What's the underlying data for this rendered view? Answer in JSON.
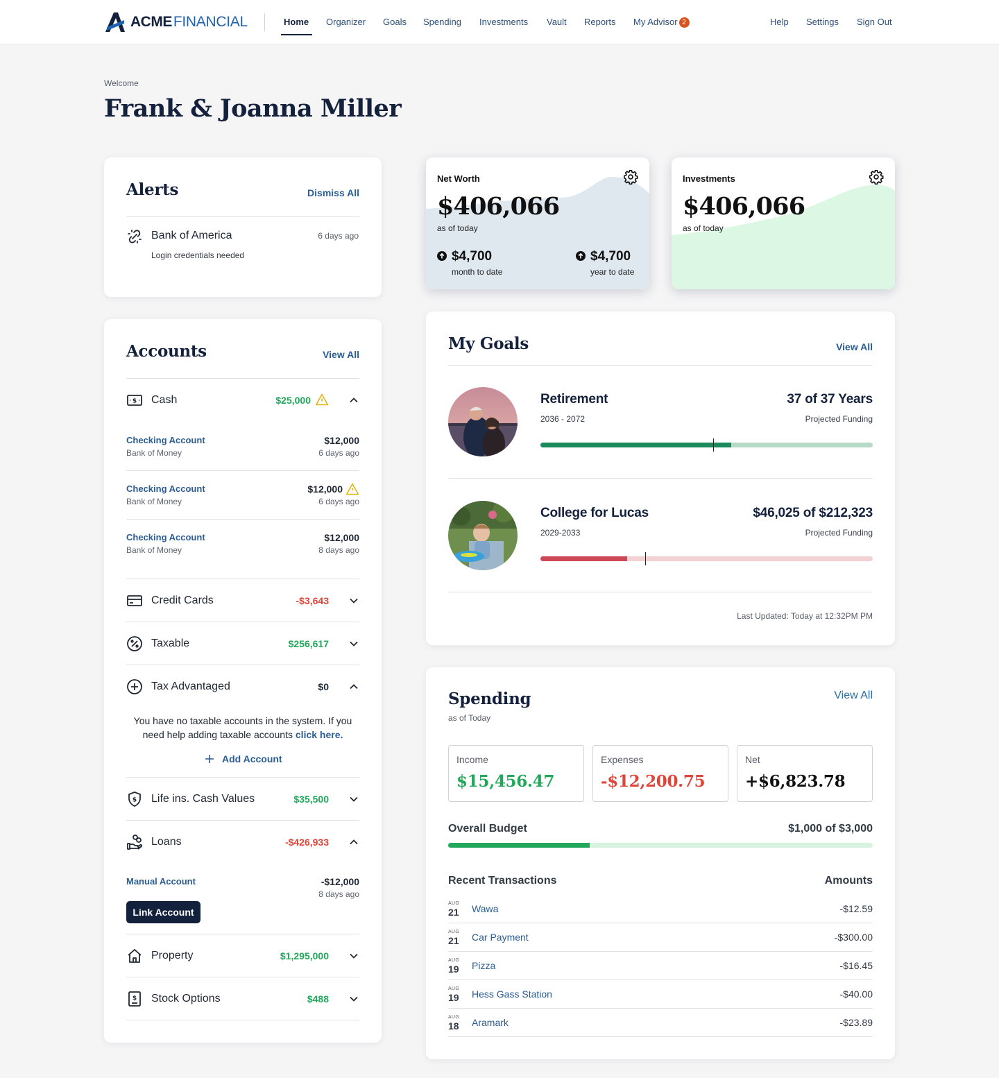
{
  "brand": {
    "name_bold": "ACME",
    "name_light": "FINANCIAL",
    "accent": "#1f64b0",
    "navy": "#14213d"
  },
  "nav": {
    "items": [
      {
        "label": "Home",
        "active": true
      },
      {
        "label": "Organizer"
      },
      {
        "label": "Goals"
      },
      {
        "label": "Spending"
      },
      {
        "label": "Investments"
      },
      {
        "label": "Vault"
      },
      {
        "label": "Reports"
      },
      {
        "label": "My Advisor",
        "badge": "2"
      }
    ],
    "right": [
      {
        "label": "Help"
      },
      {
        "label": "Settings"
      },
      {
        "label": "Sign Out"
      }
    ]
  },
  "welcome": {
    "label": "Welcome",
    "name": "Frank & Joanna Miller"
  },
  "alerts": {
    "title": "Alerts",
    "dismiss_label": "Dismiss All",
    "items": [
      {
        "name": "Bank of America",
        "time": "6 days ago",
        "message": "Login credentials needed",
        "icon": "broken-link-icon"
      }
    ]
  },
  "accounts": {
    "title": "Accounts",
    "view_all": "View All",
    "categories": [
      {
        "name": "Cash",
        "value": "$25,000",
        "tone": "green",
        "warning": true,
        "expanded": true,
        "icon": "cash-icon",
        "sub_accounts": [
          {
            "name": "Checking Account",
            "bank": "Bank of Money",
            "amount": "$12,000",
            "time": "6 days ago"
          },
          {
            "name": "Checking Account",
            "bank": "Bank of Money",
            "amount": "$12,000",
            "time": "6 days ago",
            "warning": true
          },
          {
            "name": "Checking Account",
            "bank": "Bank of Money",
            "amount": "$12,000",
            "time": "8 days ago"
          }
        ]
      },
      {
        "name": "Credit Cards",
        "value": "-$3,643",
        "tone": "red",
        "expanded": false,
        "icon": "credit-card-icon"
      },
      {
        "name": "Taxable",
        "value": "$256,617",
        "tone": "green",
        "expanded": false,
        "icon": "percent-icon"
      },
      {
        "name": "Tax Advantaged",
        "value": "$0",
        "tone": "dark",
        "expanded": true,
        "icon": "plus-circle-icon",
        "empty_note": "You have no taxable accounts in the system. If you need help adding taxable accounts",
        "empty_link": "click here.",
        "add_label": "Add Account"
      },
      {
        "name": "Life ins. Cash Values",
        "value": "$35,500",
        "tone": "green",
        "expanded": false,
        "icon": "shield-dollar-icon"
      },
      {
        "name": "Loans",
        "value": "-$426,933",
        "tone": "red",
        "expanded": true,
        "icon": "hand-coins-icon",
        "sub_accounts": [
          {
            "name": "Manual Account",
            "amount": "-$12,000",
            "time": "8 days ago",
            "button": "Link Account"
          }
        ]
      },
      {
        "name": "Property",
        "value": "$1,295,000",
        "tone": "green",
        "expanded": false,
        "icon": "house-icon"
      },
      {
        "name": "Stock Options",
        "value": "$488",
        "tone": "green",
        "expanded": false,
        "icon": "stock-doc-icon"
      }
    ]
  },
  "net_worth": {
    "label": "Net Worth",
    "value": "$406,066",
    "as_of": "as of today",
    "mtd": {
      "amount": "$4,700",
      "label": "month to date"
    },
    "ytd": {
      "amount": "$4,700",
      "label": "year to date"
    },
    "bg": "#dfe8ef"
  },
  "investments": {
    "label": "Investments",
    "value": "$406,066",
    "as_of": "as of today",
    "bg": "#dcf7e4"
  },
  "goals": {
    "title": "My Goals",
    "view_all": "View All",
    "items": [
      {
        "name": "Retirement",
        "years": "2036 - 2072",
        "status": "37 of 37 Years",
        "sub": "Projected Funding",
        "progress": 0.575,
        "marker": 0.52,
        "fill": "#1a8a5c",
        "track": "#b6d9c8"
      },
      {
        "name": "College for Lucas",
        "years": "2029-2033",
        "status": "$46,025 of $212,323",
        "sub": "Projected Funding",
        "progress": 0.26,
        "marker": 0.315,
        "fill": "#cd4757",
        "track": "#f2d0d4"
      }
    ],
    "last_updated": "Last Updated: Today at 12:32PM PM"
  },
  "spending": {
    "title": "Spending",
    "as_of": "as of Today",
    "view_all": "View All",
    "income": {
      "label": "Income",
      "value": "$15,456.47"
    },
    "expenses": {
      "label": "Expenses",
      "value": "-$12,200.75"
    },
    "net": {
      "label": "Net",
      "value": "+$6,823.78"
    },
    "budget": {
      "label": "Overall Budget",
      "value": "$1,000 of $3,000",
      "progress": 0.333
    },
    "tx_header": "Recent Transactions",
    "amount_header": "Amounts",
    "transactions": [
      {
        "month": "AUG",
        "day": "21",
        "name": "Wawa",
        "amount": "-$12.59"
      },
      {
        "month": "AUG",
        "day": "21",
        "name": "Car Payment",
        "amount": "-$300.00"
      },
      {
        "month": "AUG",
        "day": "19",
        "name": "Pizza",
        "amount": "-$16.45"
      },
      {
        "month": "AUG",
        "day": "19",
        "name": "Hess Gass Station",
        "amount": "-$40.00"
      },
      {
        "month": "AUG",
        "day": "18",
        "name": "Aramark",
        "amount": "-$23.89"
      }
    ]
  }
}
